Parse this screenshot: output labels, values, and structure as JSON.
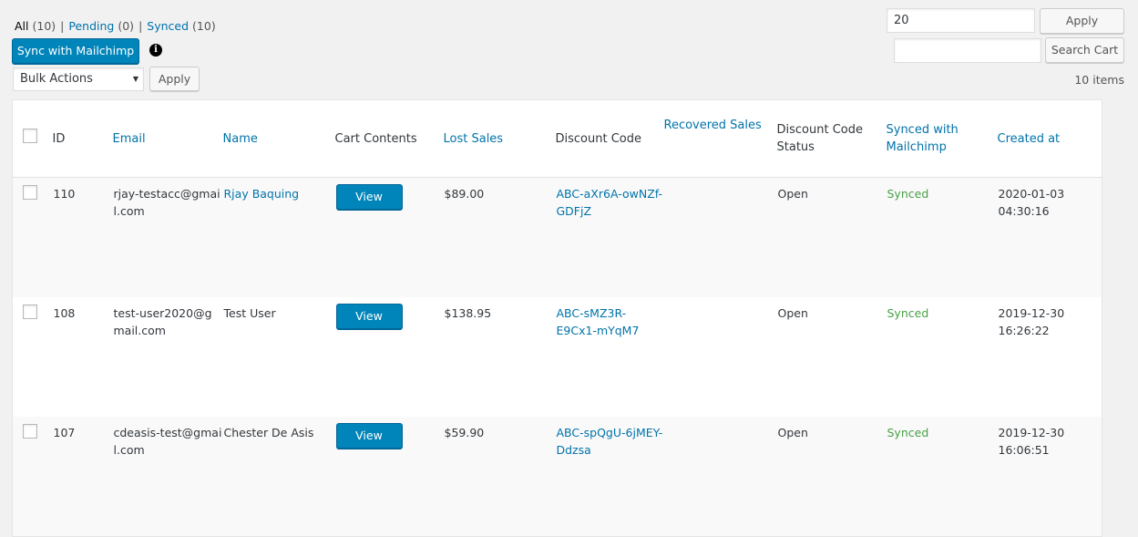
{
  "filters": {
    "all_label": "All",
    "all_count": "(10)",
    "pending_label": "Pending",
    "pending_count": "(0)",
    "synced_label": "Synced",
    "synced_count": "(10)",
    "separator": "|"
  },
  "toolbar": {
    "sync_label": "Sync with Mailchimp",
    "info_icon": "i",
    "bulk_actions_value": "Bulk Actions",
    "bulk_apply_label": "Apply",
    "per_page_value": "20",
    "per_page_apply_label": "Apply",
    "search_value": "",
    "search_button_label": "Search Cart",
    "items_count": "10 items"
  },
  "table": {
    "headers": {
      "id": "ID",
      "email": "Email",
      "name": "Name",
      "cart_contents": "Cart Contents",
      "lost_sales": "Lost Sales",
      "discount_code": "Discount Code",
      "recovered_sales": "Recovered Sales",
      "discount_code_status": "Discount Code Status",
      "synced_with_mailchimp": "Synced with Mailchimp",
      "created_at": "Created at"
    },
    "rows": [
      {
        "id": "110",
        "email": "rjay-testacc@gmail.com",
        "name": "Rjay Baquing",
        "name_is_link": true,
        "view_label": "View",
        "lost_sales": "$89.00",
        "discount_code": "ABC-aXr6A-owNZf-GDFjZ",
        "recovered_sales": "",
        "status": "Open",
        "synced": "Synced",
        "created_date": "2020-01-03",
        "created_time": "04:30:16"
      },
      {
        "id": "108",
        "email": "test-user2020@gmail.com",
        "name": "Test User",
        "name_is_link": false,
        "view_label": "View",
        "lost_sales": "$138.95",
        "discount_code": "ABC-sMZ3R-E9Cx1-mYqM7",
        "recovered_sales": "",
        "status": "Open",
        "synced": "Synced",
        "created_date": "2019-12-30",
        "created_time": "16:26:22"
      },
      {
        "id": "107",
        "email": "cdeasis-test@gmail.com",
        "name": "Chester De Asis",
        "name_is_link": false,
        "view_label": "View",
        "lost_sales": "$59.90",
        "discount_code": "ABC-spQgU-6jMEY-Ddzsa",
        "recovered_sales": "",
        "status": "Open",
        "synced": "Synced",
        "created_date": "2019-12-30",
        "created_time": "16:06:51"
      }
    ]
  },
  "colors": {
    "primary_button": "#0085ba",
    "link": "#0073aa",
    "synced_text": "#46a046",
    "page_background": "#f1f1f1"
  }
}
